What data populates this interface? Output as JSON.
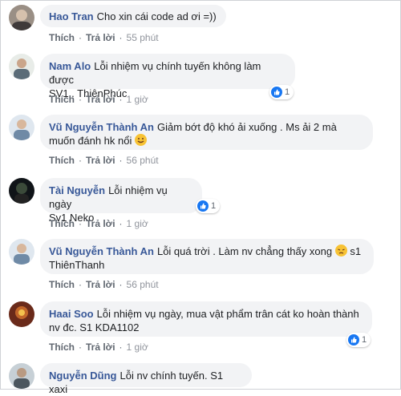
{
  "actions": {
    "like": "Thích",
    "reply": "Trả lời",
    "separator": "·"
  },
  "comments": [
    {
      "author": "Hao Tran",
      "text": "Cho xin cái code ad ơi =))",
      "time": "55 phút"
    },
    {
      "author": "Nam Alo",
      "text": "Lỗi nhiệm vụ chính tuyến không làm được",
      "text2": "SV1 . ThiênPhúc",
      "time": "1 giờ",
      "reactions": "1"
    },
    {
      "author": "Vũ Nguyễn Thành An",
      "text": "Giảm bớt độ khó ải xuống . Ms ải 2 mà",
      "text2": "muốn đánh hk nổi",
      "emoji": "rolling-on-floor-laughing-emoji",
      "time": "56 phút"
    },
    {
      "author": "Tài Nguyễn",
      "text": "Lỗi nhiệm vụ ngày",
      "text2": "Sv1 Neko",
      "time": "1 giờ",
      "reactions": "1"
    },
    {
      "author": "Vũ Nguyễn Thành An",
      "text": "Lỗi quá trời . Làm nv chẳng thấy xong",
      "text_after_emoji": "s1",
      "text2": "ThiênThanh",
      "emoji": "pensive-face-emoji",
      "time": "56 phút"
    },
    {
      "author": "Haai Soo",
      "text": "Lỗi nhiệm vụ ngày, mua vật phẩm trân cát ko hoàn thành",
      "text2": "nv đc. S1 KDA1102",
      "time": "1 giờ",
      "reactions": "1"
    },
    {
      "author": "Nguyễn Dũng",
      "text": "Lỗi nv chính tuyến. S1 xaxi"
    }
  ],
  "colors": {
    "author": "#385898",
    "bubble": "#f2f3f5",
    "like": "#1877f2",
    "meta": "#606770"
  }
}
